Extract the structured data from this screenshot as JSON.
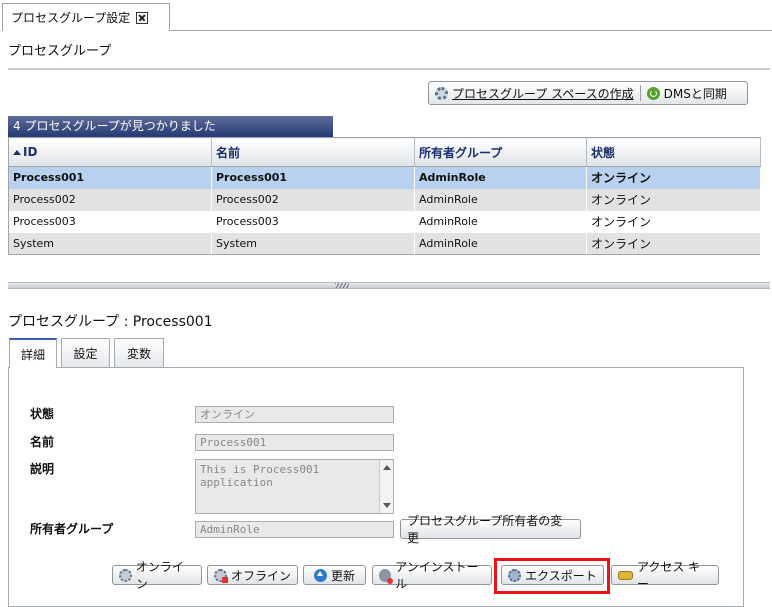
{
  "top_tab": {
    "label": "プロセスグループ設定"
  },
  "section": {
    "title": "プロセスグループ"
  },
  "toolbar": {
    "create_space": "プロセスグループ スペースの作成",
    "sync_dms": "DMSと同期"
  },
  "table": {
    "caption": "4 プロセスグループが見つかりました",
    "columns": [
      "ID",
      "名前",
      "所有者グループ",
      "状態"
    ],
    "rows": [
      [
        "Process001",
        "Process001",
        "AdminRole",
        "オンライン"
      ],
      [
        "Process002",
        "Process002",
        "AdminRole",
        "オンライン"
      ],
      [
        "Process003",
        "Process003",
        "AdminRole",
        "オンライン"
      ],
      [
        "System",
        "System",
        "AdminRole",
        "オンライン"
      ]
    ]
  },
  "detail": {
    "title": "プロセスグループ : Process001",
    "tabs": [
      "詳細",
      "設定",
      "変数"
    ],
    "fields": {
      "status_label": "状態",
      "status_value": "オンライン",
      "name_label": "名前",
      "name_value": "Process001",
      "desc_label": "説明",
      "desc_value": "This is Process001 application",
      "owner_label": "所有者グループ",
      "owner_value": "AdminRole"
    },
    "change_owner": "プロセスグループ所有者の変更",
    "buttons": {
      "online": "オンライン",
      "offline": "オフライン",
      "refresh": "更新",
      "uninstall": "アンインストール",
      "export": "エクスポート",
      "access_key": "アクセス キー"
    }
  },
  "colors": {
    "caption_bg": "#253a73",
    "header_text": "#1b2f6e",
    "selected_row": "#b7d1ef",
    "highlight": "#e8141a"
  }
}
